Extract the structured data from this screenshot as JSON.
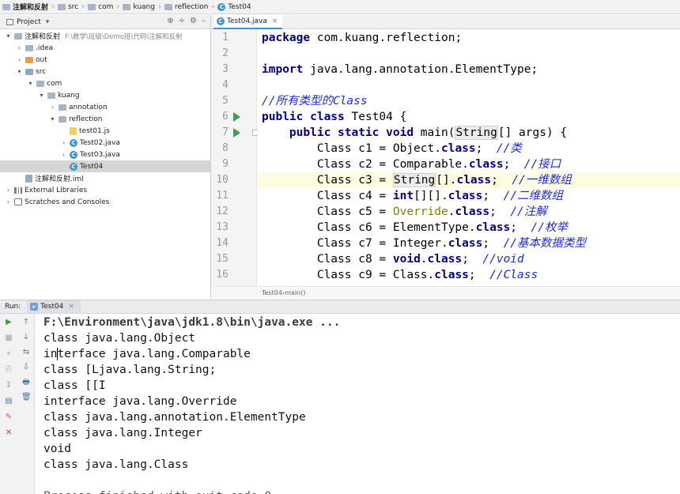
{
  "breadcrumb": {
    "items": [
      {
        "label": "注解和反射",
        "icon": "project-icon"
      },
      {
        "label": "src",
        "icon": "folder-icon"
      },
      {
        "label": "com",
        "icon": "package-icon"
      },
      {
        "label": "kuang",
        "icon": "package-icon"
      },
      {
        "label": "reflection",
        "icon": "package-icon"
      },
      {
        "label": "Test04",
        "icon": "class-icon"
      }
    ]
  },
  "project_panel": {
    "title": "Project",
    "dropdown_glyph": "▾",
    "tools": [
      "⊕",
      "÷",
      "⚙",
      "–"
    ],
    "tree": [
      {
        "label": "注解和反射",
        "note": "F:\\教学\\班级\\Demo班\\代码\\注解和反射",
        "level": 0,
        "arrow": "▾",
        "icon": "folder-icon"
      },
      {
        "label": ".idea",
        "level": 1,
        "arrow": "›",
        "icon": "folder-icon"
      },
      {
        "label": "out",
        "level": 1,
        "arrow": "›",
        "icon": "folder-orange-icon"
      },
      {
        "label": "src",
        "level": 1,
        "arrow": "▾",
        "icon": "folder-blue-icon"
      },
      {
        "label": "com",
        "level": 2,
        "arrow": "▾",
        "icon": "package-icon"
      },
      {
        "label": "kuang",
        "level": 3,
        "arrow": "▾",
        "icon": "package-icon"
      },
      {
        "label": "annotation",
        "level": 4,
        "arrow": "›",
        "icon": "package-icon"
      },
      {
        "label": "reflection",
        "level": 4,
        "arrow": "▾",
        "icon": "package-icon"
      },
      {
        "label": "test01.js",
        "level": 5,
        "arrow": "",
        "icon": "js-file-icon"
      },
      {
        "label": "Test02.java",
        "level": 5,
        "arrow": "›",
        "icon": "class-icon"
      },
      {
        "label": "Test03.java",
        "level": 5,
        "arrow": "›",
        "icon": "class-icon"
      },
      {
        "label": "Test04",
        "level": 5,
        "arrow": "",
        "icon": "class-icon",
        "selected": true
      },
      {
        "label": "注解和反射.iml",
        "level": 1,
        "arrow": "",
        "icon": "iml-file-icon"
      },
      {
        "label": "External Libraries",
        "level": 0,
        "arrow": "›",
        "icon": "library-icon"
      },
      {
        "label": "Scratches and Consoles",
        "level": 0,
        "arrow": "›",
        "icon": "scratch-icon"
      }
    ]
  },
  "editor": {
    "tab_label": "Test04.java",
    "tab_close": "×",
    "current_line": 10,
    "lines": [
      {
        "n": "1",
        "segs": [
          {
            "t": "package ",
            "c": "kw"
          },
          {
            "t": "com.kuang.reflection;"
          }
        ]
      },
      {
        "n": "2",
        "segs": []
      },
      {
        "n": "3",
        "segs": [
          {
            "t": "import ",
            "c": "kw"
          },
          {
            "t": "java.lang.annotation.ElementType;"
          }
        ]
      },
      {
        "n": "4",
        "segs": []
      },
      {
        "n": "5",
        "segs": [
          {
            "t": "//所有类型的Class",
            "c": "cm"
          }
        ]
      },
      {
        "n": "6",
        "segs": [
          {
            "t": "public class ",
            "c": "kw"
          },
          {
            "t": "Test04 {"
          }
        ]
      },
      {
        "n": "7",
        "segs": [
          {
            "t": "    "
          },
          {
            "t": "public static void ",
            "c": "kw"
          },
          {
            "t": "main("
          },
          {
            "t": "String",
            "c": "hl"
          },
          {
            "t": "[] args) {"
          }
        ]
      },
      {
        "n": "8",
        "segs": [
          {
            "t": "        Class c1 = Object."
          },
          {
            "t": "class",
            "c": "kw"
          },
          {
            "t": ";  "
          },
          {
            "t": "//类",
            "c": "cm"
          }
        ]
      },
      {
        "n": "9",
        "segs": [
          {
            "t": "        Class c2 = Comparable."
          },
          {
            "t": "class",
            "c": "kw"
          },
          {
            "t": ";  "
          },
          {
            "t": "//接口",
            "c": "cm"
          }
        ]
      },
      {
        "n": "10",
        "segs": [
          {
            "t": "        Class c3 = "
          },
          {
            "t": "String",
            "c": "hl"
          },
          {
            "t": "[]."
          },
          {
            "t": "class",
            "c": "kw"
          },
          {
            "t": ";  "
          },
          {
            "t": "//一维数组",
            "c": "cm"
          }
        ]
      },
      {
        "n": "11",
        "segs": [
          {
            "t": "        Class c4 = "
          },
          {
            "t": "int",
            "c": "kw"
          },
          {
            "t": "[][]."
          },
          {
            "t": "class",
            "c": "kw"
          },
          {
            "t": ";  "
          },
          {
            "t": "//二维数组",
            "c": "cm"
          }
        ]
      },
      {
        "n": "12",
        "segs": [
          {
            "t": "        Class c5 = "
          },
          {
            "t": "Override",
            "c": "ann"
          },
          {
            "t": "."
          },
          {
            "t": "class",
            "c": "kw"
          },
          {
            "t": ";  "
          },
          {
            "t": "//注解",
            "c": "cm"
          }
        ]
      },
      {
        "n": "13",
        "segs": [
          {
            "t": "        Class c6 = ElementType."
          },
          {
            "t": "class",
            "c": "kw"
          },
          {
            "t": ";  "
          },
          {
            "t": "//枚举",
            "c": "cm"
          }
        ]
      },
      {
        "n": "14",
        "segs": [
          {
            "t": "        Class c7 = Integer."
          },
          {
            "t": "class",
            "c": "kw"
          },
          {
            "t": ";  "
          },
          {
            "t": "//基本数据类型",
            "c": "cm"
          }
        ]
      },
      {
        "n": "15",
        "segs": [
          {
            "t": "        Class c8 = "
          },
          {
            "t": "void",
            "c": "kw"
          },
          {
            "t": "."
          },
          {
            "t": "class",
            "c": "kw"
          },
          {
            "t": ";  "
          },
          {
            "t": "//void",
            "c": "cm"
          }
        ]
      },
      {
        "n": "16",
        "segs": [
          {
            "t": "        Class c9 = Class."
          },
          {
            "t": "class",
            "c": "kw"
          },
          {
            "t": ";  "
          },
          {
            "t": "//Class",
            "c": "cm"
          }
        ]
      }
    ],
    "run_marks": [
      "6",
      "7"
    ],
    "fold_marks": [
      "7"
    ],
    "structure_crumbs": [
      "Test04",
      "main()"
    ]
  },
  "run_panel": {
    "label": "Run:",
    "tab_label": "Test04",
    "tab_close": "×",
    "left_tools": [
      "▶",
      "■",
      "⏸",
      "⎘",
      "↧",
      "▤",
      "✎",
      "✕"
    ],
    "right_tools": [
      "↑",
      "↓",
      "⇆",
      "⇩",
      "🖶",
      "🗑"
    ],
    "command": "F:\\Environment\\java\\jdk1.8\\bin\\java.exe ...",
    "output": [
      "class java.lang.Object",
      "interface java.lang.Comparable",
      "class [Ljava.lang.String;",
      "class [[I",
      "interface java.lang.Override",
      "class java.lang.annotation.ElementType",
      "class java.lang.Integer",
      "void",
      "class java.lang.Class",
      "",
      "Process finished with exit code 0"
    ]
  }
}
